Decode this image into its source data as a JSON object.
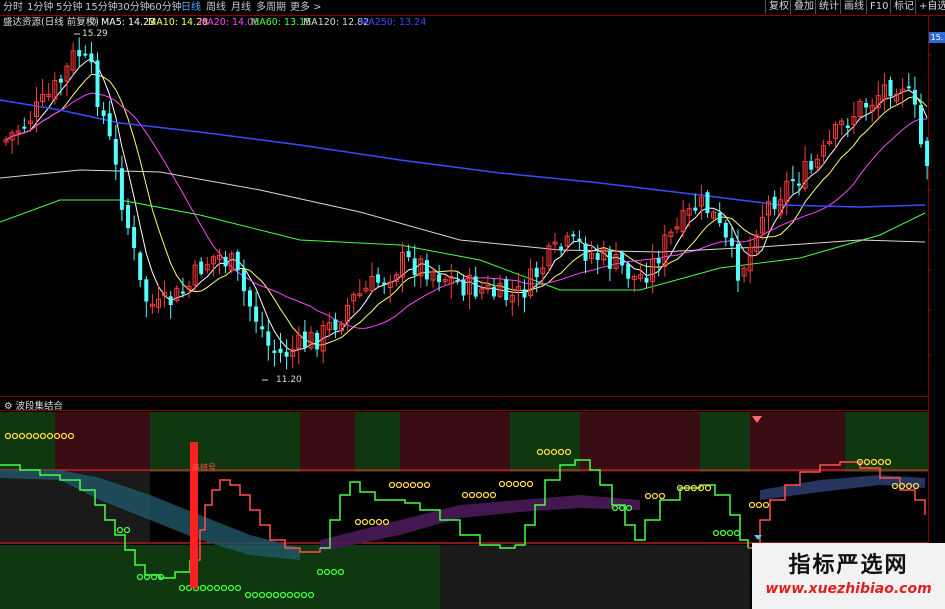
{
  "toolbar": {
    "periods": [
      "分时",
      "1分钟",
      "5分钟",
      "15分钟",
      "30分钟",
      "60分钟",
      "日线",
      "周线",
      "月线",
      "多周期",
      "更多 >"
    ],
    "active_period": "日线",
    "right_buttons": [
      "复权",
      "叠加",
      "统计",
      "画线",
      "F10",
      "标记",
      "+自选"
    ]
  },
  "ma_legend": {
    "title": "盛达资源(日线 前复权)",
    "ma5": "MA5: 14.23",
    "ma10": "MA10: 14.28",
    "ma20": "MA20: 14.06",
    "ma60": "MA60: 13.15",
    "ma120": "MA120: 12.82",
    "ma250": "MA250: 13.24"
  },
  "colors": {
    "up": "#ff3b3b",
    "down": "#54ffff",
    "ma5": "#ffffff",
    "ma10": "#ffff66",
    "ma20": "#ff44ff",
    "ma60": "#44ff44",
    "ma120": "#d8d8d8",
    "ma250": "#3b4bff"
  },
  "price_high_label": "15.29",
  "price_low_label": "11.20",
  "axis_tag": "15.",
  "indicator": {
    "title": "波段集结合",
    "signal_text": "集结号"
  },
  "watermark": {
    "title": "指标严选网",
    "url": "www.xuezhibiao.com"
  }
}
